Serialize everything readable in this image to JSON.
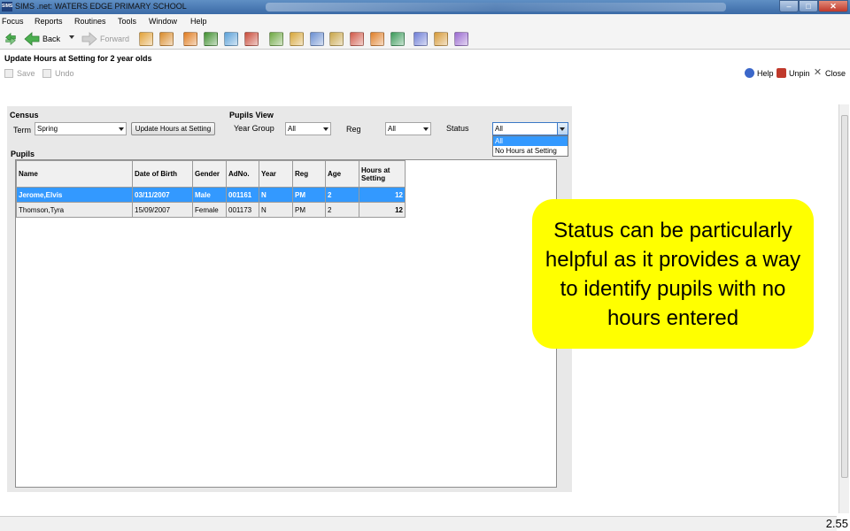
{
  "window": {
    "app_icon": "SIMS",
    "title": "SIMS .net: WATERS EDGE PRIMARY SCHOOL",
    "controls": {
      "minimize": "–",
      "maximize": "□",
      "close": "✕"
    }
  },
  "menu": [
    "Focus",
    "Reports",
    "Routines",
    "Tools",
    "Window",
    "Help"
  ],
  "toolbar": {
    "back_label": "Back",
    "forward_label": "Forward",
    "icon_colors": [
      "#e2a23a",
      "#d98b2b",
      "#e07b1f",
      "#3f8f2f",
      "#5aa0d8",
      "#c94b3a",
      "#6ea843",
      "#d7a63a",
      "#6b8fd1",
      "#c9a64a",
      "#d15a4a",
      "#e0802a",
      "#3b9a5a",
      "#6f7ed6",
      "#d69a38",
      "#9a6ad0"
    ]
  },
  "module": {
    "title": "Update Hours at Setting for 2 year olds",
    "save_label": "Save",
    "undo_label": "Undo",
    "help_label": "Help",
    "unpin_label": "Unpin",
    "close_label": "Close"
  },
  "census": {
    "group_label": "Census",
    "term_label": "Term",
    "term_value": "Spring",
    "update_button": "Update Hours at Setting"
  },
  "pupils_view": {
    "group_label": "Pupils View",
    "year_group_label": "Year Group",
    "year_group_value": "All",
    "reg_label": "Reg",
    "reg_value": "All",
    "status_label": "Status",
    "status_value": "All",
    "status_options": [
      "All",
      "No Hours at Setting"
    ]
  },
  "pupils": {
    "group_label": "Pupils",
    "columns": [
      "Name",
      "Date of Birth",
      "Gender",
      "AdNo.",
      "Year",
      "Reg",
      "Age",
      "Hours at Setting"
    ],
    "rows": [
      {
        "name": "Jerome,Elvis",
        "dob": "03/11/2007",
        "gender": "Male",
        "adno": "001161",
        "year": "N",
        "reg": "PM",
        "age": "2",
        "hours": "12"
      },
      {
        "name": "Thomson,Tyra",
        "dob": "15/09/2007",
        "gender": "Female",
        "adno": "001173",
        "year": "N",
        "reg": "PM",
        "age": "2",
        "hours": "12"
      }
    ]
  },
  "callout": {
    "text": "Status can be particularly helpful as it provides a way to identify pupils with no hours entered"
  },
  "page_number": "2.55"
}
